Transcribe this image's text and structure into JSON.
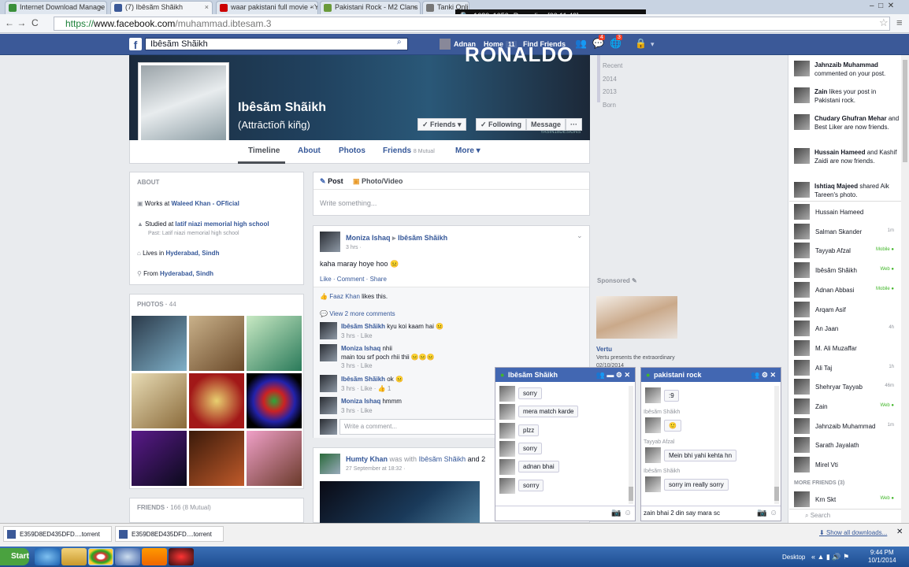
{
  "browser": {
    "tabs": [
      {
        "label": "Internet Download Manage",
        "color": "#3a8f3a"
      },
      {
        "label": "(7) Ibêsãm Shãikh",
        "color": "#3b5998"
      },
      {
        "label": "waar pakistani full movie - Yo",
        "color": "#cc0000"
      },
      {
        "label": "Pakistani Rock - M2 Clans - T",
        "color": "#6a9a3a"
      },
      {
        "label": "Tanki Online",
        "color": "#777777"
      }
    ],
    "url_scheme": "https://",
    "url_domain": "www.facebook.com",
    "url_path": "/muhammad.ibtesam.3"
  },
  "recorder": {
    "resolution": "1680x1050",
    "status": "Recording [00:11:49]"
  },
  "fb_header": {
    "logo": "f",
    "search_value": "Ibêsãm Shãikh",
    "user": "Adnan",
    "home": "Home",
    "home_count": "11",
    "find_friends": "Find Friends",
    "friend_requests_count": "4",
    "notifications_count": "3"
  },
  "cover": {
    "banner_text": "RONALDO",
    "watermark": "YASIN18DESIGNS",
    "name": "Ibêsãm Shãikh",
    "subtitle": "(Attrāctīoñ kiñg)",
    "friends_btn": "✓ Friends ▾",
    "following_btn": "✓ Following",
    "message_btn": "Message",
    "more_btn": "···"
  },
  "profile_tabs": {
    "timeline": "Timeline",
    "about": "About",
    "photos": "Photos",
    "friends": "Friends",
    "friends_mutual": "8 Mutual",
    "more": "More ▾"
  },
  "timeline_years": [
    "Recent",
    "2014",
    "2013",
    "Born"
  ],
  "about": {
    "title": "ABOUT",
    "work_prefix": "Works at",
    "work": "Waleed Khan - OFficial",
    "study_prefix": "Studied at",
    "study": "latif niazi memorial high school",
    "study_past": "Past: Latif niazi memorial high school",
    "lives_prefix": "Lives in",
    "lives": "Hyderabad, Sindh",
    "from_prefix": "From",
    "from": "Hyderabad, Sindh"
  },
  "photos": {
    "title": "PHOTOS",
    "count": "44"
  },
  "friends_box": {
    "title": "FRIENDS",
    "count": "166 (8 Mutual)"
  },
  "composer": {
    "post": "Post",
    "photo_video": "Photo/Video",
    "placeholder": "Write something..."
  },
  "post1": {
    "author": "Moniza Ishaq",
    "arrow": "▸",
    "target": "Ibêsãm Shãikh",
    "time": "3 hrs ·",
    "text": "kaha maray hoye hoo",
    "actions": "Like · Comment · Share",
    "likes_name": "Faaz Khan",
    "likes_suffix": "likes this.",
    "view_more": "View 2 more comments",
    "comments": [
      {
        "author": "Ibêsãm Shãikh",
        "text": "kyu koi kaam hai",
        "meta": "3 hrs · Like"
      },
      {
        "author": "Moniza Ishaq",
        "text": "nhii",
        "text2": "main tou srf poch rhii thii",
        "meta": "3 hrs · Like"
      },
      {
        "author": "Ibêsãm Shãikh",
        "text": "ok",
        "meta": "3 hrs · Like · 👍 1"
      },
      {
        "author": "Moniza Ishaq",
        "text": "hmmm",
        "meta": "3 hrs · Like"
      }
    ],
    "comment_placeholder": "Write a comment..."
  },
  "post2": {
    "author": "Humty Khan",
    "with": "was with",
    "target": "Ibêsãm Shãikh",
    "and": "and 2",
    "time": "27 September at 18:32 ·"
  },
  "sponsored": {
    "title": "Sponsored",
    "brand": "Vertu",
    "text": "Vertu presents the extraordinary 02/10/2014"
  },
  "ticker": [
    {
      "name": "Jahnzaib Muhammad",
      "text": "commented on your post."
    },
    {
      "name": "Zain",
      "text": "likes your post in Pakistani rock."
    },
    {
      "name": "Chudary Ghufran Mehar",
      "text": "and Best Liker are now friends."
    },
    {
      "name": "Hussain Hameed",
      "text": "and Kashif Zaidi are now friends."
    },
    {
      "name": "Ishtiaq Majeed",
      "text": "shared Aik Tareen's photo."
    }
  ],
  "chat_list": [
    {
      "name": "Hussain Hameed",
      "status": ""
    },
    {
      "name": "Salman Skander",
      "status": "1m"
    },
    {
      "name": "Tayyab Afzal",
      "status": "Mobile ●"
    },
    {
      "name": "Ibêsãm Shãikh",
      "status": "Web ●"
    },
    {
      "name": "Adnan Abbasi",
      "status": "Mobile ●"
    },
    {
      "name": "Arqam Asif",
      "status": ""
    },
    {
      "name": "An Jaan",
      "status": "4h"
    },
    {
      "name": "M. Ali Muzaffar",
      "status": ""
    },
    {
      "name": "Ali Taj",
      "status": "1h"
    },
    {
      "name": "Shehryar Tayyab",
      "status": "46m"
    },
    {
      "name": "Zain",
      "status": "Web ●"
    },
    {
      "name": "Jahnzaib Muhammad",
      "status": "1m"
    },
    {
      "name": "Sarath Jayalath",
      "status": ""
    },
    {
      "name": "Mirel Vti",
      "status": ""
    }
  ],
  "more_friends": "MORE FRIENDS (3)",
  "chat_last": {
    "name": "Krn Skt",
    "status": "Web ●"
  },
  "chat_search": "Search",
  "chat1": {
    "title": "Ibêsãm Shãikh",
    "messages": [
      "sorry",
      "mera match karde",
      "plzz",
      "sorry",
      "adnan bhai",
      "sorrry"
    ]
  },
  "chat2": {
    "title": "pakistani rock",
    "messages": [
      {
        "sender": "",
        "text": ":9"
      },
      {
        "sender": "Ibêsãm Shãikh",
        "text": "🙂"
      },
      {
        "sender": "Tayyab Afzal",
        "text": "Mein bhi yahi kehta hn"
      },
      {
        "sender": "Ibêsãm Shãikh",
        "text": "sorry im really sorry"
      }
    ],
    "input_value": "zain bhai 2 din say mara sc"
  },
  "downloads": {
    "item1": "E359D8ED435DFD....torrent",
    "item2": "E359D8ED435DFD....torrent",
    "show_all": "Show all downloads..."
  },
  "taskbar": {
    "start": "Start",
    "desktop": "Desktop",
    "time": "9:44 PM",
    "date": "10/1/2014"
  }
}
